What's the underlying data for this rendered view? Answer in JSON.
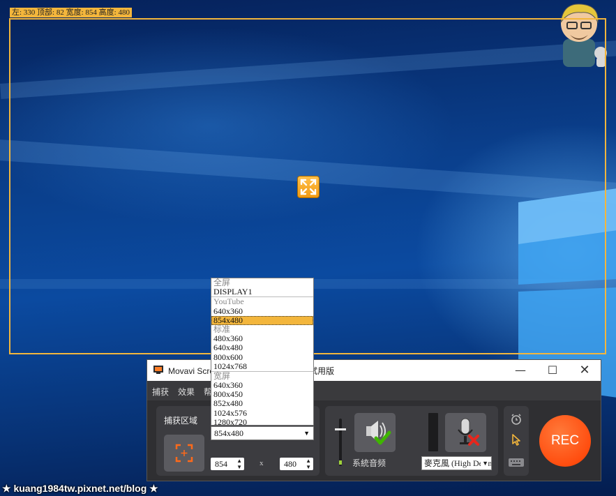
{
  "capture_info": "左: 330 顶部: 82 宽度: 854 高度: 480",
  "window": {
    "title": "Movavi Screen Capture Screen – 7 天试用版",
    "minimize_icon": "minimize-icon",
    "maximize_icon": "maximize-icon",
    "close_icon": "close-icon"
  },
  "menu": [
    "捕获",
    "效果",
    "帮助"
  ],
  "capture_panel": {
    "label": "捕获区域",
    "selected_resolution": "854x480",
    "width": "854",
    "height": "480",
    "times_sign": "x"
  },
  "resolution_list": [
    {
      "text": "全屏",
      "kind": "group"
    },
    {
      "text": "DISPLAY1",
      "kind": "option"
    },
    {
      "text": "YouTube",
      "kind": "group",
      "sep": true
    },
    {
      "text": "640x360",
      "kind": "option"
    },
    {
      "text": "854x480",
      "kind": "option",
      "selected": true
    },
    {
      "text": "标准",
      "kind": "group"
    },
    {
      "text": "480x360",
      "kind": "option"
    },
    {
      "text": "640x480",
      "kind": "option"
    },
    {
      "text": "800x600",
      "kind": "option"
    },
    {
      "text": "1024x768",
      "kind": "option"
    },
    {
      "text": "宽屏",
      "kind": "group",
      "sep": true
    },
    {
      "text": "640x360",
      "kind": "option"
    },
    {
      "text": "800x450",
      "kind": "option"
    },
    {
      "text": "852x480",
      "kind": "option"
    },
    {
      "text": "1024x576",
      "kind": "option"
    },
    {
      "text": "1280x720",
      "kind": "option"
    }
  ],
  "audio_panel": {
    "system_audio_label": "系統音频",
    "system_audio_icon": "speaker-check-icon",
    "mic_icon": "microphone-off-icon",
    "mic_device": "麥克風 (High Definition Audio)"
  },
  "side_panel_icons": [
    "alarm-clock-icon",
    "cursor-icon",
    "keyboard-icon"
  ],
  "rec_label": "REC",
  "watermark": "★ kuang1984tw.pixnet.net/blog ★",
  "colors": {
    "accent": "#f3b63c",
    "rec": "#ff4d0f",
    "panel": "#3c3c40"
  }
}
